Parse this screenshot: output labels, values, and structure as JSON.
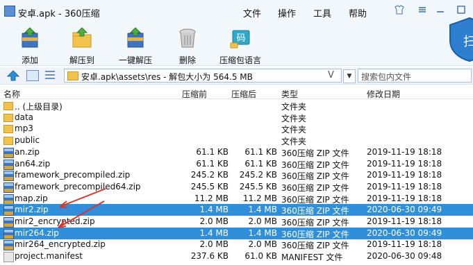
{
  "window": {
    "title": "安卓.apk - 360压缩",
    "menu": [
      "文件",
      "操作",
      "工具",
      "帮助"
    ]
  },
  "toolbar": {
    "tools": [
      "添加",
      "解压到",
      "一键解压",
      "删除",
      "压缩包语言"
    ],
    "shield_label": "扫"
  },
  "address": {
    "path": "安卓.apk\\assets\\res - 解包大小为 564.5 MB",
    "v_label": "V",
    "search_placeholder": "搜索包内文件"
  },
  "columns": [
    "名称",
    "压缩前",
    "压缩后",
    "类型",
    "修改日期"
  ],
  "files": [
    {
      "name": ".. (上级目录)",
      "orig": "",
      "comp": "",
      "type": "文件夹",
      "date": "",
      "icon": "folder"
    },
    {
      "name": "data",
      "orig": "",
      "comp": "",
      "type": "文件夹",
      "date": "",
      "icon": "folder"
    },
    {
      "name": "mp3",
      "orig": "",
      "comp": "",
      "type": "文件夹",
      "date": "",
      "icon": "folder"
    },
    {
      "name": "public",
      "orig": "",
      "comp": "",
      "type": "文件夹",
      "date": "",
      "icon": "folder"
    },
    {
      "name": "an.zip",
      "orig": "61.1 KB",
      "comp": "61.1 KB",
      "type": "360压缩 ZIP 文件",
      "date": "2019-11-19 18:18",
      "icon": "zip"
    },
    {
      "name": "an64.zip",
      "orig": "61.1 KB",
      "comp": "61.1 KB",
      "type": "360压缩 ZIP 文件",
      "date": "2019-11-19 18:18",
      "icon": "zip"
    },
    {
      "name": "framework_precompiled.zip",
      "orig": "245.2 KB",
      "comp": "245.2 KB",
      "type": "360压缩 ZIP 文件",
      "date": "2019-11-19 18:18",
      "icon": "zip"
    },
    {
      "name": "framework_precompiled64.zip",
      "orig": "245.5 KB",
      "comp": "245.5 KB",
      "type": "360压缩 ZIP 文件",
      "date": "2019-11-19 18:18",
      "icon": "zip"
    },
    {
      "name": "map.zip",
      "orig": "11.2 MB",
      "comp": "11.2 MB",
      "type": "360压缩 ZIP 文件",
      "date": "2019-11-19 18:18",
      "icon": "zip"
    },
    {
      "name": "mir2.zip",
      "orig": "1.4 MB",
      "comp": "1.4 MB",
      "type": "360压缩 ZIP 文件",
      "date": "2020-06-30 09:49",
      "icon": "zip",
      "selected": true
    },
    {
      "name": "mir2_encrypted.zip",
      "orig": "2.0 MB",
      "comp": "2.0 MB",
      "type": "360压缩 ZIP 文件",
      "date": "2019-11-19 18:18",
      "icon": "zip"
    },
    {
      "name": "mir264.zip",
      "orig": "1.4 MB",
      "comp": "1.4 MB",
      "type": "360压缩 ZIP 文件",
      "date": "2020-06-30 09:49",
      "icon": "zip",
      "selected": true
    },
    {
      "name": "mir264_encrypted.zip",
      "orig": "2.0 MB",
      "comp": "2.0 MB",
      "type": "360压缩 ZIP 文件",
      "date": "2019-11-19 18:18",
      "icon": "zip"
    },
    {
      "name": "project.manifest",
      "orig": "237.6 KB",
      "comp": "61.0 KB",
      "type": "MANIFEST 文件",
      "date": "2020-06-30 09:48",
      "icon": "file"
    }
  ],
  "colors": {
    "selection": "#2f8fdb",
    "arrow": "#d9362b"
  }
}
